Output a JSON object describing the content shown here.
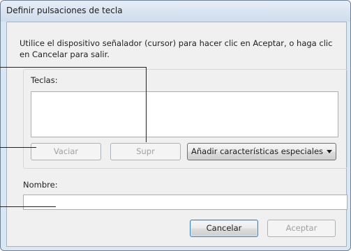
{
  "dialog": {
    "title": "Definir pulsaciones de tecla",
    "instructions": "Utilice el dispositivo señalador (cursor) para hacer clic en Aceptar, o haga clic en Cancelar para salir."
  },
  "keys": {
    "label": "Teclas:",
    "value": "",
    "clear_label": "Vaciar",
    "delete_label": "Supr",
    "special_combo_value": "Añadir características especiales"
  },
  "name": {
    "label": "Nombre:",
    "value": ""
  },
  "footer": {
    "cancel_label": "Cancelar",
    "ok_label": "Aceptar"
  }
}
